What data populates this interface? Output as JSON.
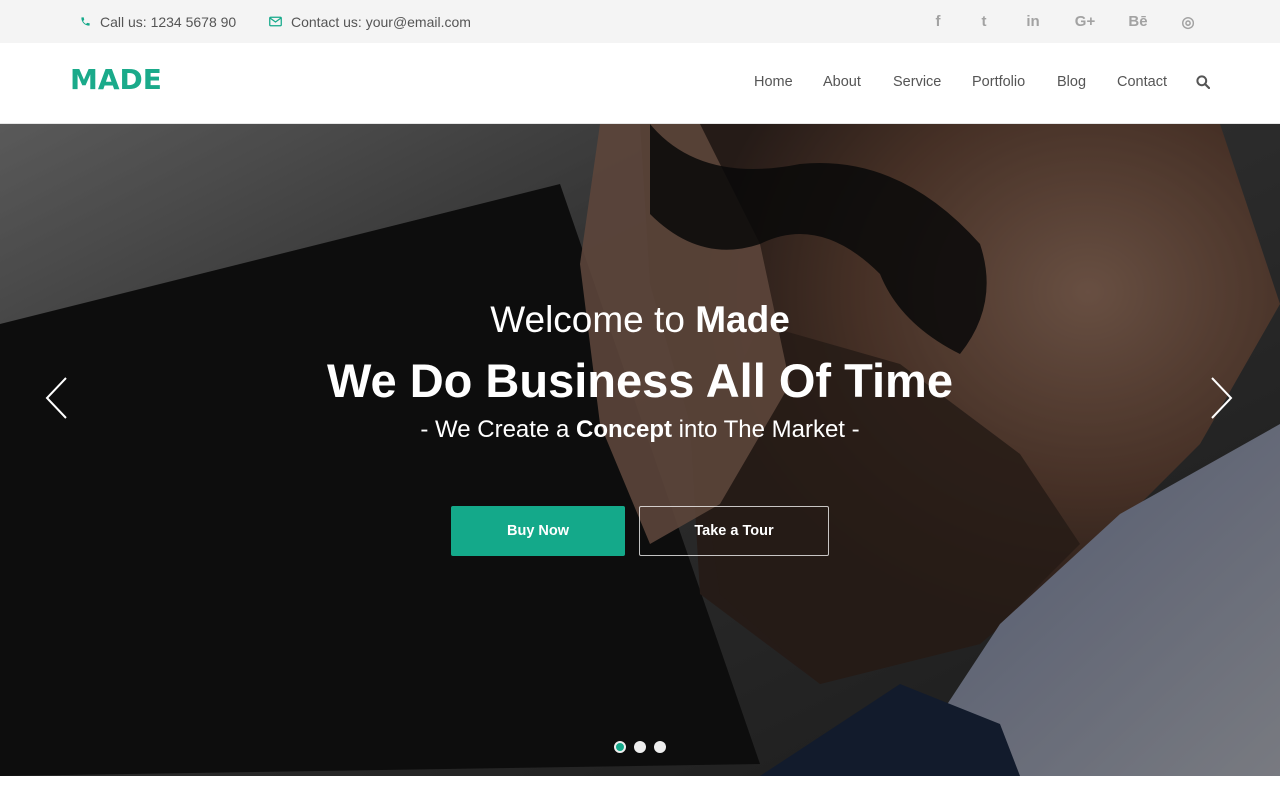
{
  "topbar": {
    "phone": "Call us: 1234 5678 90",
    "email": "Contact us: your@email.com",
    "social": [
      {
        "icon": "facebook-icon",
        "glyph": "f"
      },
      {
        "icon": "twitter-icon",
        "glyph": "t"
      },
      {
        "icon": "linkedin-icon",
        "glyph": "in"
      },
      {
        "icon": "google-plus-icon",
        "glyph": "G+"
      },
      {
        "icon": "behance-icon",
        "glyph": "Bē"
      },
      {
        "icon": "dribbble-icon",
        "glyph": "◎"
      }
    ]
  },
  "header": {
    "logo": "MADE",
    "nav": [
      "Home",
      "About",
      "Service",
      "Portfolio",
      "Blog",
      "Contact"
    ]
  },
  "hero": {
    "welcome_prefix": "Welcome to",
    "welcome_brand": "Made",
    "headline": "We Do Business All Of Time",
    "tagline_prefix": "- We Create a",
    "tagline_bold": "Concept",
    "tagline_suffix": "into The Market -",
    "primary_button": "Buy Now",
    "secondary_button": "Take a Tour",
    "slide_count": 3,
    "active_slide": 1
  },
  "colors": {
    "accent": "#14a98a",
    "topbar_bg": "#f4f4f4",
    "nav_text": "#555555"
  }
}
